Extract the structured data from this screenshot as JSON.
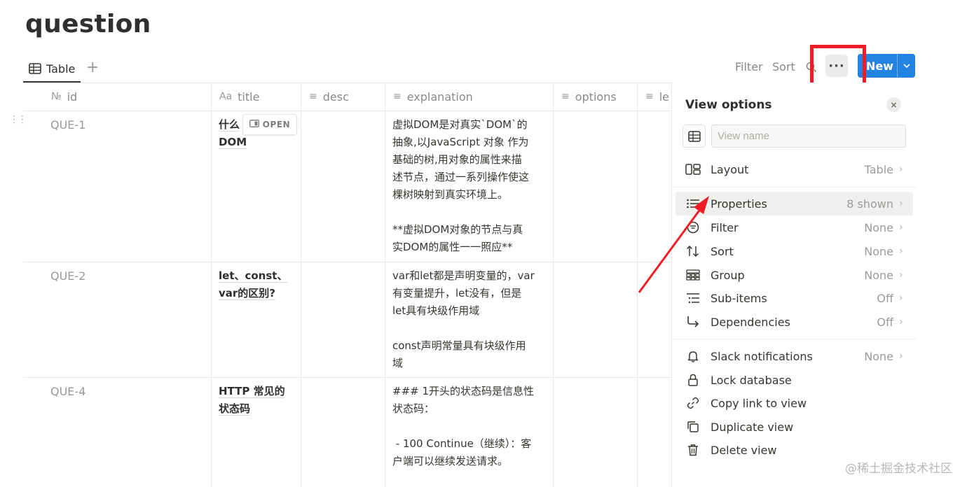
{
  "page": {
    "title": "question"
  },
  "view_bar": {
    "tab_label": "Table",
    "add_view": "+",
    "filter_label": "Filter",
    "sort_label": "Sort",
    "more_label": "···",
    "new_label": "New",
    "new_chevron": "⌄"
  },
  "table": {
    "columns": [
      {
        "icon": "№",
        "label": "id"
      },
      {
        "icon": "Aa",
        "label": "title"
      },
      {
        "icon": "≡",
        "label": "desc"
      },
      {
        "icon": "≡",
        "label": "explanation"
      },
      {
        "icon": "≡",
        "label": "options"
      },
      {
        "icon": "≡",
        "label": "le"
      }
    ],
    "open_label": "OPEN",
    "rows": [
      {
        "id": "QUE-1",
        "title": "什么\nDOM",
        "desc": "",
        "explanation": "虚拟DOM是对真实`DOM`的\n抽象,以JavaScript 对象 作为\n基础的树,用对象的属性来描\n述节点，通过一系列操作使这\n棵树映射到真实环境上。\n\n**虚拟DOM对象的节点与真\n实DOM的属性一一照应**"
      },
      {
        "id": "QUE-2",
        "title": "let、const、\nvar的区别?",
        "desc": "",
        "explanation": "var和let都是声明变量的，var\n有变量提升，let没有，但是\nlet具有块级作用域\n\nconst声明常量具有块级作用\n域"
      },
      {
        "id": "QUE-4",
        "title": "HTTP 常见的\n状态码",
        "desc": "",
        "explanation": "### 1开头的状态码是信息性\n状态码：\n\n - 100 Continue（继续）：客\n户端可以继续发送请求。"
      }
    ]
  },
  "view_options": {
    "title": "View options",
    "close": "×",
    "view_name_placeholder": "View name",
    "items": [
      {
        "icon": "layout-icon",
        "label": "Layout",
        "value": "Table"
      },
      {
        "icon": "properties-icon",
        "label": "Properties",
        "value": "8 shown"
      },
      {
        "icon": "filter-icon",
        "label": "Filter",
        "value": "None"
      },
      {
        "icon": "sort-icon",
        "label": "Sort",
        "value": "None"
      },
      {
        "icon": "group-icon",
        "label": "Group",
        "value": "None"
      },
      {
        "icon": "subitems-icon",
        "label": "Sub-items",
        "value": "Off"
      },
      {
        "icon": "dependencies-icon",
        "label": "Dependencies",
        "value": "Off"
      },
      {
        "icon": "bell-icon",
        "label": "Slack notifications",
        "value": "None"
      },
      {
        "icon": "lock-icon",
        "label": "Lock database",
        "value": ""
      },
      {
        "icon": "link-icon",
        "label": "Copy link to view",
        "value": ""
      },
      {
        "icon": "duplicate-icon",
        "label": "Duplicate view",
        "value": ""
      },
      {
        "icon": "trash-icon",
        "label": "Delete view",
        "value": ""
      }
    ]
  },
  "watermark": "@稀土掘金技术社区",
  "colors": {
    "accent": "#2383e2",
    "annotation": "#ee1c24"
  }
}
